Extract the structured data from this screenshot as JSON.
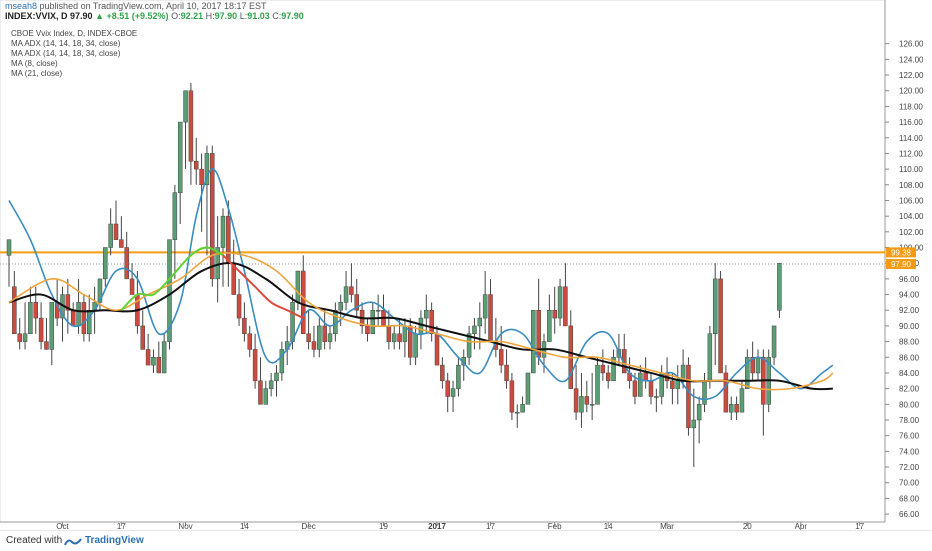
{
  "header": {
    "author": "mseah8",
    "published_text": "published on TradingView.com, April 10, 2017 18:17 EST",
    "symbol_line": "INDEX:VVIX, D",
    "last": "97.90",
    "change": "+8.51 (+9.52%)",
    "open_label": "O:",
    "open": "92.21",
    "high_label": "H:",
    "high": "97.90",
    "low_label": "L:",
    "low": "91.03",
    "close_label": "C:",
    "close": "97.90"
  },
  "legend": [
    "CBOE Vvix Index, D, INDEX-CBOE",
    "MA ADX (14, 14, 18, 34, close)",
    "MA ADX (14, 14, 18, 34, close)",
    "MA (8, close)",
    "MA (21, close)"
  ],
  "footer": {
    "created_with": "Created with",
    "brand": "TradingView"
  },
  "colors": {
    "up": "#5b9e74",
    "down": "#cc4b3f",
    "ma8": "#3a8dc1",
    "ma21": "#111111",
    "adx_green": "#5fd234",
    "adx_red": "#e04a3c",
    "adx_orange": "#f0a43a",
    "hline": "#f39c12",
    "current_price": "#f39c12"
  },
  "chart_data": {
    "type": "candlestick",
    "y_ticks": [
      "66.00",
      "68.00",
      "70.00",
      "72.00",
      "74.00",
      "76.00",
      "78.00",
      "80.00",
      "82.00",
      "84.00",
      "86.00",
      "88.00",
      "90.00",
      "92.00",
      "94.00",
      "96.00",
      "98.00",
      "100.00",
      "102.00",
      "104.00",
      "106.00",
      "108.00",
      "110.00",
      "112.00",
      "114.00",
      "116.00",
      "118.00",
      "120.00",
      "122.00",
      "124.00",
      "126.00"
    ],
    "ylim": [
      65.5,
      128
    ],
    "x_ticks": [
      {
        "i": 10,
        "label": "Oct",
        "bold": false
      },
      {
        "i": 21,
        "label": "17",
        "bold": false
      },
      {
        "i": 33,
        "label": "Nov",
        "bold": false
      },
      {
        "i": 44,
        "label": "14",
        "bold": false
      },
      {
        "i": 56,
        "label": "Dec",
        "bold": false
      },
      {
        "i": 70,
        "label": "19",
        "bold": false
      },
      {
        "i": 80,
        "label": "2017",
        "bold": true
      },
      {
        "i": 90,
        "label": "17",
        "bold": false
      },
      {
        "i": 102,
        "label": "Feb",
        "bold": false
      },
      {
        "i": 112,
        "label": "14",
        "bold": false
      },
      {
        "i": 123,
        "label": "Mar",
        "bold": false
      },
      {
        "i": 138,
        "label": "20",
        "bold": false
      },
      {
        "i": 148,
        "label": "Apr",
        "bold": false
      },
      {
        "i": 159,
        "label": "17",
        "bold": false
      }
    ],
    "horizontal_line": {
      "value": 99.38,
      "label": "99.38"
    },
    "current_price": {
      "value": 97.9,
      "label": "97.90"
    },
    "candles": [
      [
        99,
        101,
        95,
        101
      ],
      [
        95,
        97,
        89,
        89
      ],
      [
        89,
        91,
        87,
        88
      ],
      [
        88,
        93,
        87,
        89
      ],
      [
        89,
        95,
        89,
        93
      ],
      [
        93,
        95,
        89,
        91
      ],
      [
        91,
        93,
        87,
        88
      ],
      [
        88,
        91,
        87,
        87
      ],
      [
        87,
        93,
        85,
        93
      ],
      [
        93,
        96,
        90,
        91
      ],
      [
        91,
        95,
        88,
        94
      ],
      [
        94,
        96,
        89,
        92
      ],
      [
        92,
        93,
        90,
        90
      ],
      [
        90,
        96,
        89,
        93
      ],
      [
        93,
        94,
        88,
        89
      ],
      [
        89,
        94,
        88,
        92
      ],
      [
        92,
        95,
        89,
        93
      ],
      [
        93,
        96,
        92,
        96
      ],
      [
        96,
        100,
        95,
        100
      ],
      [
        100,
        105,
        99,
        103
      ],
      [
        103,
        106,
        101,
        101
      ],
      [
        101,
        104,
        100,
        100
      ],
      [
        100,
        102,
        96,
        96
      ],
      [
        96,
        98,
        94,
        94
      ],
      [
        94,
        97,
        89,
        90
      ],
      [
        90,
        92,
        87,
        87
      ],
      [
        87,
        89,
        85,
        85
      ],
      [
        85,
        87,
        84,
        86
      ],
      [
        86,
        88,
        84,
        84
      ],
      [
        84,
        89,
        84,
        88
      ],
      [
        88,
        101,
        87,
        101
      ],
      [
        101,
        108,
        96,
        107
      ],
      [
        107,
        116,
        103,
        116
      ],
      [
        116,
        120,
        110,
        120
      ],
      [
        120,
        121,
        108,
        111
      ],
      [
        111,
        114,
        108,
        110
      ],
      [
        110,
        112,
        102,
        108
      ],
      [
        108,
        113,
        99,
        112
      ],
      [
        112,
        113,
        95,
        96
      ],
      [
        96,
        104,
        93,
        100
      ],
      [
        100,
        105,
        95,
        104
      ],
      [
        104,
        106,
        95,
        98
      ],
      [
        98,
        101,
        94,
        94
      ],
      [
        94,
        96,
        90,
        91
      ],
      [
        91,
        93,
        88,
        89
      ],
      [
        89,
        90,
        86,
        87
      ],
      [
        87,
        89,
        82,
        83
      ],
      [
        83,
        86,
        80,
        80
      ],
      [
        80,
        83,
        80,
        82
      ],
      [
        82,
        84,
        81,
        83
      ],
      [
        83,
        85,
        81,
        84
      ],
      [
        84,
        88,
        83,
        87
      ],
      [
        87,
        90,
        85,
        88
      ],
      [
        88,
        94,
        87,
        93
      ],
      [
        93,
        97,
        92,
        97
      ],
      [
        97,
        99,
        89,
        89
      ],
      [
        89,
        92,
        87,
        88
      ],
      [
        88,
        90,
        86,
        87
      ],
      [
        87,
        91,
        86,
        90
      ],
      [
        90,
        92,
        87,
        88
      ],
      [
        88,
        90,
        87,
        89
      ],
      [
        89,
        93,
        88,
        92
      ],
      [
        92,
        94,
        90,
        93
      ],
      [
        93,
        97,
        92,
        95
      ],
      [
        95,
        98,
        93,
        94
      ],
      [
        94,
        96,
        91,
        92
      ],
      [
        92,
        93,
        89,
        90
      ],
      [
        90,
        91,
        88,
        89
      ],
      [
        89,
        93,
        89,
        92
      ],
      [
        92,
        94,
        90,
        92
      ],
      [
        92,
        94,
        90,
        90
      ],
      [
        90,
        92,
        87,
        88
      ],
      [
        88,
        90,
        87,
        89
      ],
      [
        89,
        91,
        87,
        88
      ],
      [
        88,
        91,
        86,
        90
      ],
      [
        90,
        91,
        85,
        86
      ],
      [
        86,
        90,
        85,
        89
      ],
      [
        89,
        92,
        87,
        91
      ],
      [
        91,
        94,
        89,
        92
      ],
      [
        92,
        93,
        88,
        89
      ],
      [
        89,
        90,
        85,
        85
      ],
      [
        85,
        86,
        82,
        83
      ],
      [
        83,
        84,
        79,
        81
      ],
      [
        81,
        83,
        79,
        82
      ],
      [
        82,
        86,
        81,
        85
      ],
      [
        85,
        87,
        83,
        86
      ],
      [
        86,
        90,
        85,
        89
      ],
      [
        89,
        91,
        87,
        90
      ],
      [
        90,
        93,
        87,
        91
      ],
      [
        91,
        97,
        89,
        94
      ],
      [
        94,
        96,
        90,
        88
      ],
      [
        88,
        91,
        86,
        87
      ],
      [
        87,
        90,
        84,
        85
      ],
      [
        85,
        87,
        82,
        83
      ],
      [
        83,
        84,
        78,
        79
      ],
      [
        79,
        80,
        77,
        79
      ],
      [
        79,
        81,
        79,
        80
      ],
      [
        80,
        84,
        80,
        84
      ],
      [
        84,
        92,
        84,
        92
      ],
      [
        92,
        96,
        85,
        86
      ],
      [
        86,
        89,
        84,
        88
      ],
      [
        88,
        94,
        88,
        92
      ],
      [
        92,
        95,
        89,
        91
      ],
      [
        91,
        96,
        90,
        95
      ],
      [
        95,
        98,
        90,
        90
      ],
      [
        90,
        92,
        82,
        82
      ],
      [
        82,
        85,
        78,
        79
      ],
      [
        79,
        84,
        77,
        81
      ],
      [
        81,
        83,
        79,
        80
      ],
      [
        80,
        84,
        78,
        80
      ],
      [
        80,
        86,
        80,
        85
      ],
      [
        85,
        87,
        83,
        84
      ],
      [
        84,
        85,
        82,
        83
      ],
      [
        83,
        87,
        83,
        86
      ],
      [
        86,
        89,
        85,
        87
      ],
      [
        87,
        89,
        84,
        84
      ],
      [
        84,
        86,
        82,
        83
      ],
      [
        83,
        84,
        80,
        81
      ],
      [
        81,
        85,
        81,
        84
      ],
      [
        84,
        86,
        82,
        83
      ],
      [
        83,
        84,
        80,
        81
      ],
      [
        81,
        82,
        79,
        81
      ],
      [
        81,
        85,
        80,
        84
      ],
      [
        84,
        86,
        82,
        83
      ],
      [
        83,
        84,
        80,
        82
      ],
      [
        82,
        85,
        80,
        83
      ],
      [
        83,
        87,
        82,
        85
      ],
      [
        85,
        86,
        76,
        77
      ],
      [
        77,
        82,
        72,
        78
      ],
      [
        78,
        81,
        75,
        80
      ],
      [
        80,
        84,
        79,
        83
      ],
      [
        83,
        90,
        82,
        89
      ],
      [
        89,
        98,
        85,
        96
      ],
      [
        96,
        97,
        84,
        84
      ],
      [
        84,
        85,
        80,
        79
      ],
      [
        79,
        81,
        78,
        80
      ],
      [
        80,
        81,
        78,
        79
      ],
      [
        79,
        83,
        79,
        82
      ],
      [
        82,
        87,
        82,
        86
      ],
      [
        86,
        88,
        83,
        84
      ],
      [
        84,
        87,
        83,
        86
      ],
      [
        86,
        87,
        76,
        80
      ],
      [
        80,
        87,
        79,
        86
      ],
      [
        86,
        90,
        85,
        90
      ],
      [
        92,
        98,
        91,
        98
      ]
    ],
    "series": [
      {
        "name": "MA (8, close)",
        "color": "#3a8dc1",
        "values": [
          [
            0,
            106
          ],
          [
            4,
            101
          ],
          [
            8,
            94
          ],
          [
            12,
            90
          ],
          [
            16,
            92
          ],
          [
            20,
            97
          ],
          [
            24,
            96
          ],
          [
            28,
            89
          ],
          [
            32,
            93
          ],
          [
            35,
            104
          ],
          [
            38,
            110
          ],
          [
            41,
            105
          ],
          [
            44,
            97
          ],
          [
            48,
            86
          ],
          [
            52,
            87
          ],
          [
            56,
            92
          ],
          [
            60,
            90
          ],
          [
            64,
            92
          ],
          [
            68,
            93
          ],
          [
            72,
            91
          ],
          [
            76,
            89
          ],
          [
            80,
            89
          ],
          [
            84,
            86
          ],
          [
            88,
            84
          ],
          [
            92,
            89
          ],
          [
            96,
            89
          ],
          [
            100,
            85
          ],
          [
            104,
            83
          ],
          [
            108,
            88
          ],
          [
            112,
            89
          ],
          [
            116,
            84
          ],
          [
            120,
            83
          ],
          [
            124,
            84
          ],
          [
            128,
            81
          ],
          [
            132,
            81
          ],
          [
            136,
            84
          ],
          [
            140,
            86
          ],
          [
            144,
            84
          ],
          [
            148,
            82
          ],
          [
            152,
            84
          ],
          [
            154,
            85
          ]
        ]
      },
      {
        "name": "MA (21, close)",
        "color": "#111111",
        "values": [
          [
            0,
            93
          ],
          [
            6,
            94
          ],
          [
            12,
            92
          ],
          [
            18,
            92
          ],
          [
            24,
            92
          ],
          [
            30,
            94
          ],
          [
            36,
            97
          ],
          [
            42,
            98
          ],
          [
            48,
            96
          ],
          [
            54,
            93
          ],
          [
            60,
            92
          ],
          [
            66,
            91
          ],
          [
            72,
            91
          ],
          [
            78,
            90
          ],
          [
            84,
            89
          ],
          [
            90,
            88
          ],
          [
            96,
            87
          ],
          [
            102,
            87
          ],
          [
            108,
            86
          ],
          [
            114,
            85
          ],
          [
            120,
            84
          ],
          [
            126,
            83
          ],
          [
            132,
            83
          ],
          [
            138,
            83
          ],
          [
            144,
            83
          ],
          [
            150,
            82
          ],
          [
            154,
            82
          ]
        ]
      },
      {
        "name": "MA ADX (14, 14, 18, 34, close)",
        "color": "#f0a43a",
        "values": [
          [
            0,
            93
          ],
          [
            8,
            96
          ],
          [
            14,
            94
          ],
          [
            20,
            92
          ],
          [
            26,
            94
          ],
          [
            32,
            96
          ],
          [
            38,
            99
          ],
          [
            44,
            99
          ],
          [
            50,
            97
          ],
          [
            56,
            93
          ],
          [
            62,
            91
          ],
          [
            68,
            90
          ],
          [
            74,
            90
          ],
          [
            80,
            89
          ],
          [
            86,
            88
          ],
          [
            92,
            88
          ],
          [
            98,
            87
          ],
          [
            104,
            86
          ],
          [
            110,
            86
          ],
          [
            116,
            85
          ],
          [
            122,
            84
          ],
          [
            128,
            83
          ],
          [
            134,
            83
          ],
          [
            140,
            82
          ],
          [
            146,
            82
          ],
          [
            152,
            83
          ],
          [
            154,
            84
          ]
        ]
      }
    ],
    "adx_segments": [
      {
        "color": "#5fd234",
        "values": [
          [
            21,
            92
          ],
          [
            24,
            94
          ],
          [
            27,
            94
          ],
          [
            30,
            96
          ],
          [
            34,
            99
          ],
          [
            37,
            100
          ],
          [
            40,
            99
          ]
        ]
      },
      {
        "color": "#e04a3c",
        "values": [
          [
            40,
            99
          ],
          [
            43,
            97
          ],
          [
            46,
            95
          ],
          [
            49,
            93
          ],
          [
            52,
            92
          ],
          [
            55,
            91
          ]
        ]
      }
    ]
  }
}
